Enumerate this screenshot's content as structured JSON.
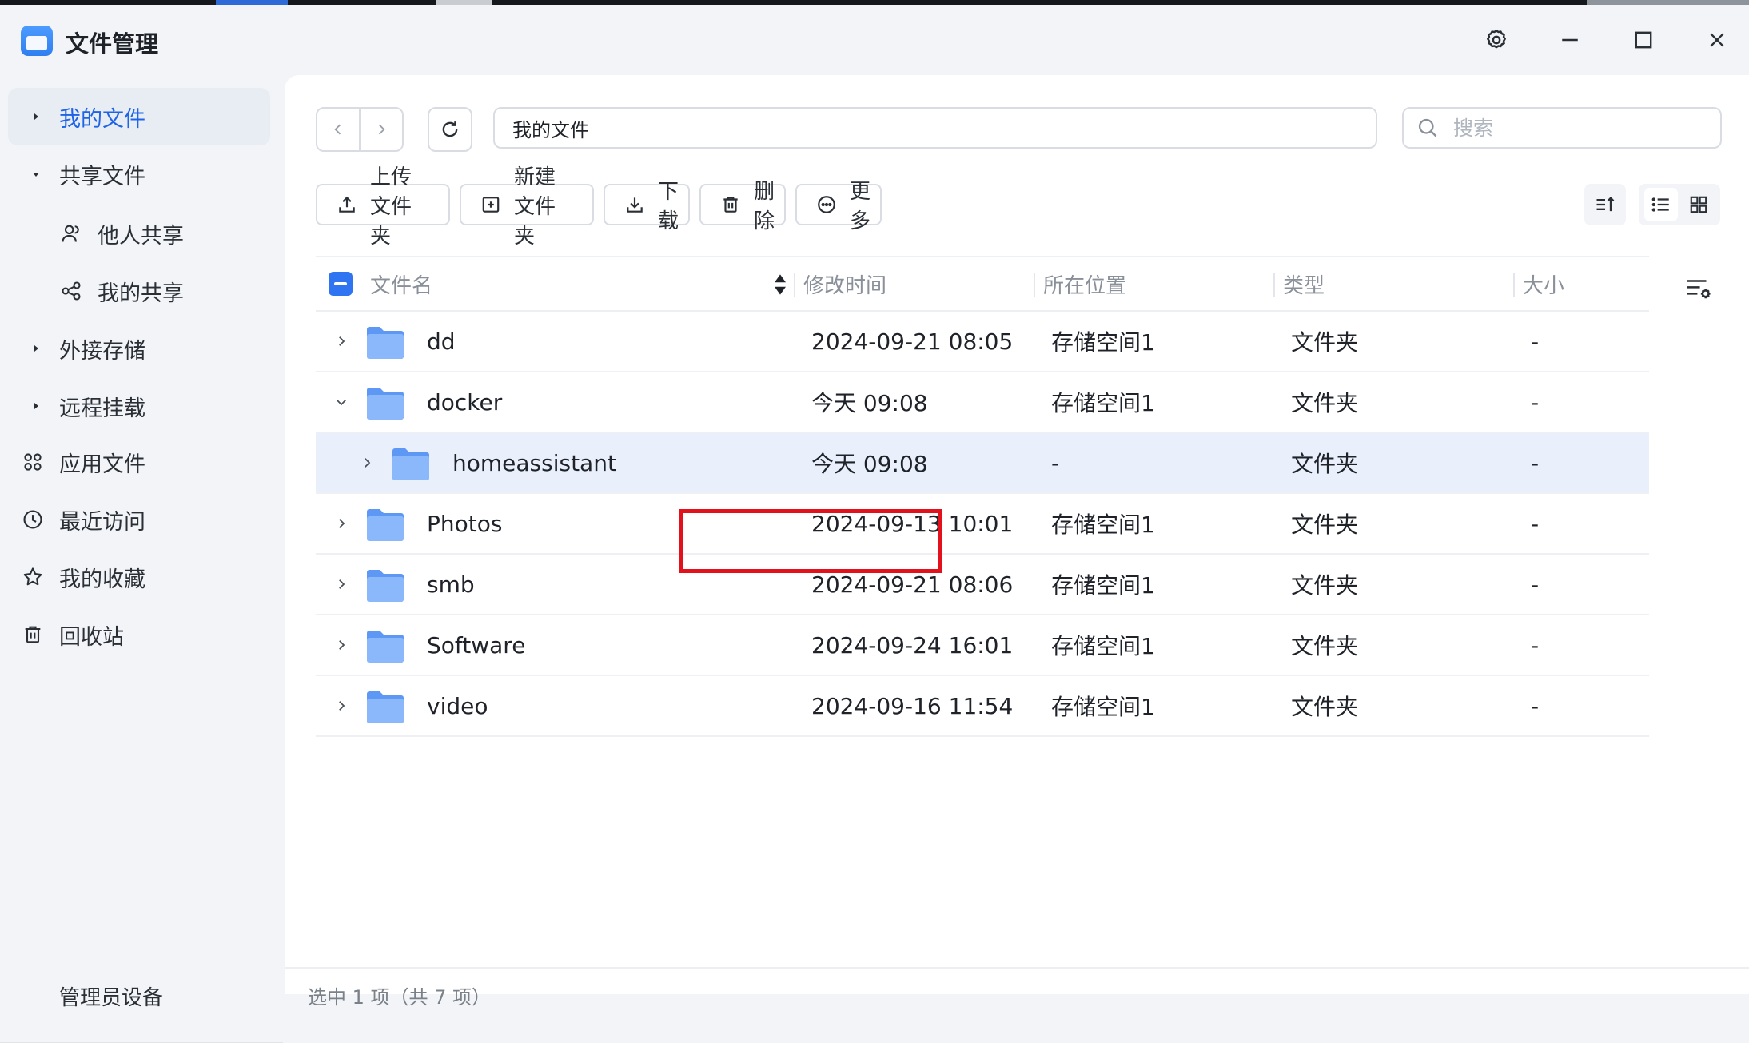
{
  "app": {
    "title": "文件管理"
  },
  "sidebar": {
    "items": [
      {
        "label": "我的文件"
      },
      {
        "label": "共享文件"
      },
      {
        "label": "他人共享"
      },
      {
        "label": "我的共享"
      },
      {
        "label": "外接存储"
      },
      {
        "label": "远程挂载"
      },
      {
        "label": "应用文件"
      },
      {
        "label": "最近访问"
      },
      {
        "label": "我的收藏"
      },
      {
        "label": "回收站"
      }
    ],
    "footer_label": "管理员设备"
  },
  "toolbar": {
    "path": "我的文件",
    "search_placeholder": "搜索",
    "upload_label": "上传文件夹",
    "new_folder_label": "新建文件夹",
    "download_label": "下载",
    "delete_label": "删除",
    "more_label": "更多"
  },
  "table": {
    "headers": {
      "name": "文件名",
      "modified": "修改时间",
      "location": "所在位置",
      "type": "类型",
      "size": "大小"
    },
    "rows": [
      {
        "name": "dd",
        "modified": "2024-09-21 08:05",
        "location": "存储空间1",
        "type": "文件夹",
        "size": "-"
      },
      {
        "name": "docker",
        "modified": "今天 09:08",
        "location": "存储空间1",
        "type": "文件夹",
        "size": "-"
      },
      {
        "name": "homeassistant",
        "modified": "今天 09:08",
        "location": "-",
        "type": "文件夹",
        "size": "-"
      },
      {
        "name": "Photos",
        "modified": "2024-09-13 10:01",
        "location": "存储空间1",
        "type": "文件夹",
        "size": "-"
      },
      {
        "name": "smb",
        "modified": "2024-09-21 08:06",
        "location": "存储空间1",
        "type": "文件夹",
        "size": "-"
      },
      {
        "name": "Software",
        "modified": "2024-09-24 16:01",
        "location": "存储空间1",
        "type": "文件夹",
        "size": "-"
      },
      {
        "name": "video",
        "modified": "2024-09-16 11:54",
        "location": "存储空间1",
        "type": "文件夹",
        "size": "-"
      }
    ]
  },
  "status": {
    "text": "选中 1 项（共 7 项）"
  },
  "colors": {
    "accent": "#1d64e6",
    "folder": "#7fb0fb",
    "highlight": "#e3111b"
  }
}
